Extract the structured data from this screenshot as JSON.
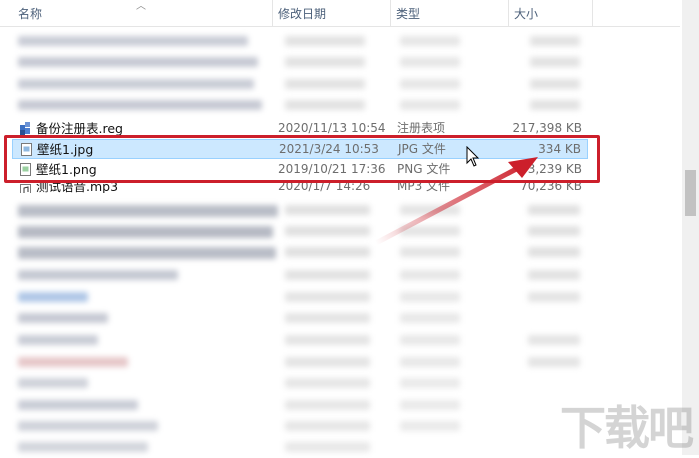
{
  "columns": {
    "name": "名称",
    "date": "修改日期",
    "type": "类型",
    "size": "大小"
  },
  "rows": [
    {
      "name": "备份注册表.reg",
      "date": "2020/11/13 10:54",
      "type": "注册表项",
      "size": "217,398 KB"
    },
    {
      "name": "壁纸1.jpg",
      "date": "2021/3/24 10:53",
      "type": "JPG 文件",
      "size": "334 KB"
    },
    {
      "name": "壁纸1.png",
      "date": "2019/10/21 17:36",
      "type": "PNG 文件",
      "size": "3,239 KB"
    },
    {
      "name": "测试语音.mp3",
      "date": "2020/1/7 14:26",
      "type": "MP3 文件",
      "size": "70,236 KB"
    }
  ],
  "watermark": "下载吧",
  "colors": {
    "highlight_border": "#cc1f2b",
    "selected_row": "#cce8ff",
    "arrow": "#cc1f2b"
  }
}
